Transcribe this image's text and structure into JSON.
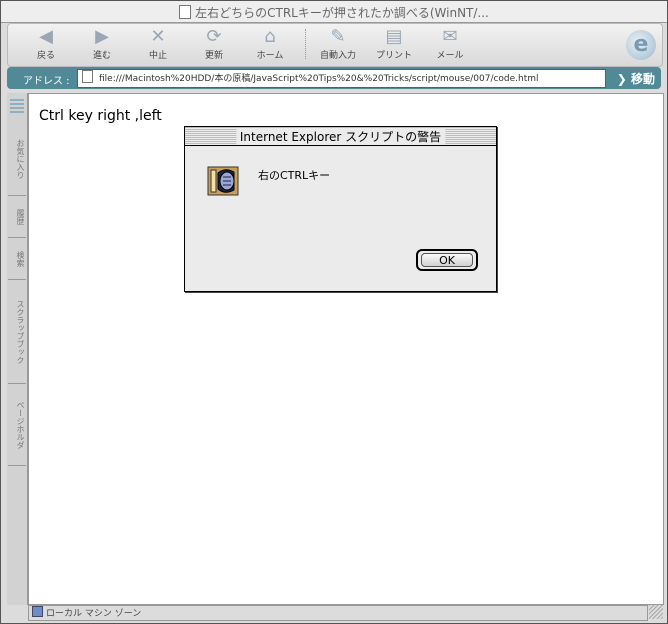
{
  "window": {
    "title": "左右どちらのCTRLキーが押されたか調べる(WinNT/..."
  },
  "toolbar": {
    "buttons": [
      {
        "label": "戻る",
        "icon": "back-arrow-icon"
      },
      {
        "label": "進む",
        "icon": "forward-arrow-icon"
      },
      {
        "label": "中止",
        "icon": "stop-icon"
      },
      {
        "label": "更新",
        "icon": "refresh-icon"
      },
      {
        "label": "ホーム",
        "icon": "home-icon"
      },
      {
        "label": "自動入力",
        "icon": "autofill-icon"
      },
      {
        "label": "プリント",
        "icon": "print-icon"
      },
      {
        "label": "メール",
        "icon": "mail-icon"
      }
    ]
  },
  "address": {
    "label": "アドレス :",
    "url": "file:///Macintosh%20HDD/本の原稿/JavaScript%20Tips%20&%20Tricks/script/mouse/007/code.html",
    "go_label": "移動"
  },
  "sidebar": {
    "tabs": [
      "お気に入り",
      "履歴",
      "検索",
      "スクラップブック",
      "ページホルダ"
    ]
  },
  "content": {
    "text": "Ctrl key right ,left"
  },
  "dialog": {
    "title": "Internet Explorer スクリプトの警告",
    "message": "右のCTRLキー",
    "ok_label": "OK"
  },
  "status": {
    "zone": "ローカル マシン ゾーン"
  }
}
